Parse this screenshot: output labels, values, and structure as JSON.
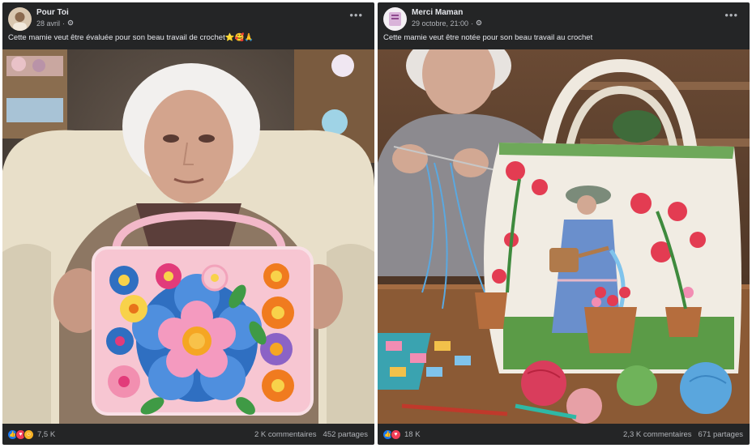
{
  "posts": [
    {
      "author": "Pour Toi",
      "date": "28 avril",
      "caption": "Cette mamie veut être évaluée pour son beau travail de crochet⭐🥰🙏",
      "reactions": "7,5 K",
      "comments": "2 K commentaires",
      "shares": "452 partages"
    },
    {
      "author": "Merci Maman",
      "date": "29 octobre, 21:00",
      "caption": "Cette mamie veut être notée pour son beau travail au crochet",
      "reactions": "18 K",
      "comments": "2,3 K commentaires",
      "shares": "671 partages"
    }
  ],
  "icons": {
    "privacy": "gear-icon",
    "more": "more-options-icon",
    "like": "like-reaction-icon",
    "love": "love-reaction-icon",
    "care": "care-reaction-icon"
  },
  "colors": {
    "card_bg": "#242526",
    "text_primary": "#e4e6eb",
    "text_secondary": "#b0b3b8",
    "like_blue": "#1877f2",
    "love_red": "#f33e58"
  }
}
